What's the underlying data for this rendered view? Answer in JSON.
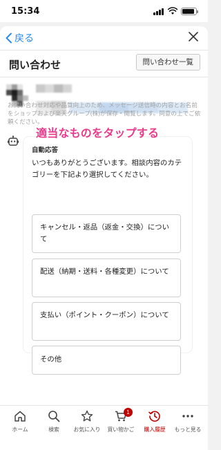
{
  "status_bar": {
    "time": "15:34"
  },
  "nav": {
    "back_label": "戻る"
  },
  "header": {
    "title": "問い合わせ",
    "list_button": "問い合わせ一覧"
  },
  "notice": "お問い合わせ対応や品質向上のため、メッセージ送信時の内容とお名前をショップおよび楽天グループ(株)が保存・閲覧します。同意の上でご依頼ください。",
  "overlay_text": "適当なものをタップする",
  "chat": {
    "header": "自動応答",
    "message": "いつもありがとうございます。相談内容のカテゴリーを下記より選択してください。",
    "options": [
      "キャンセル・返品（返金・交換）について",
      "配送（納期・送料・各種変更）について",
      "支払い（ポイント・クーポン）について",
      "その他"
    ]
  },
  "tabbar": {
    "items": [
      {
        "label": "ホーム",
        "icon": "home-icon"
      },
      {
        "label": "検索",
        "icon": "search-icon"
      },
      {
        "label": "お気に入り",
        "icon": "star-icon"
      },
      {
        "label": "買い物かご",
        "icon": "cart-icon",
        "badge": "1"
      },
      {
        "label": "購入履歴",
        "icon": "history-icon",
        "active": true
      },
      {
        "label": "もっと見る",
        "icon": "more-icon"
      }
    ]
  },
  "colors": {
    "accent": "#bf0000",
    "link": "#2b8ae8",
    "overlay": "#ea3a8c"
  }
}
